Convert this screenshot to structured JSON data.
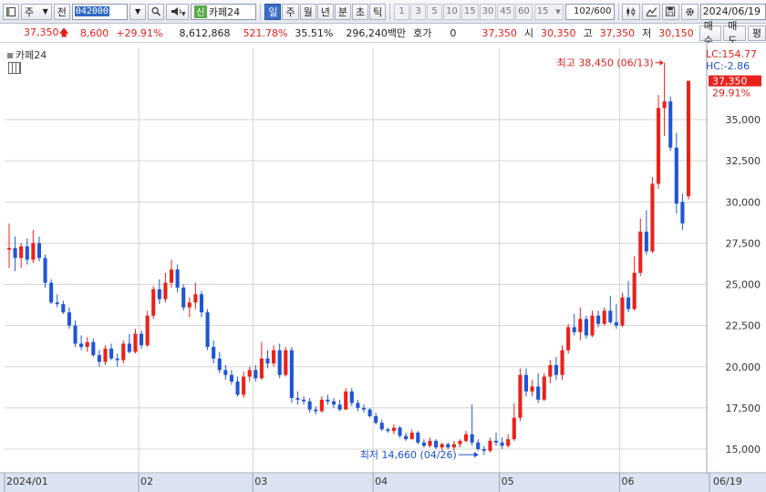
{
  "toolbar": {
    "market_label": "주",
    "all_label": "전",
    "code_value": "042000",
    "stock_badge": "신",
    "stock_name": "카페24",
    "periods": [
      "일",
      "주",
      "월",
      "년",
      "분",
      "초",
      "틱"
    ],
    "active_period": "일",
    "numbers": [
      "1",
      "3",
      "5",
      "10",
      "15",
      "30",
      "45",
      "60"
    ],
    "interval_value": "15",
    "count_value": "102",
    "count_total": "/600",
    "date_value": "2024/06/19"
  },
  "icons": [
    "window-icon",
    "dropdown-arrow-icon",
    "search-icon",
    "speaker-icon",
    "candle-icon",
    "chart-tools-icon",
    "save-icon",
    "gear-icon",
    "calculator-icon"
  ],
  "infobar": {
    "price": "37,350",
    "change": "8,600",
    "change_pct": "+29.91%",
    "volume": "8,612,868",
    "volume_ratio": "521.78%",
    "turnover": "35.51%",
    "amount": "296,240백만",
    "quote_label": "호가",
    "quote_value": "0",
    "quote_price": "37,350",
    "open_label": "시",
    "open": "30,350",
    "high_label": "고",
    "high": "37,350",
    "low_label": "저",
    "low": "30,150",
    "buy_button": "매수",
    "sell_button": "매도",
    "eval_button": "평"
  },
  "chart_data": {
    "type": "candlestick",
    "title": "카페24",
    "colors": {
      "up": "#e8221b",
      "down": "#1f56d4",
      "grid": "#d4d4d4"
    },
    "ylim": [
      14000,
      39500
    ],
    "y_ticks": [
      15000,
      17500,
      20000,
      22500,
      25000,
      27500,
      30000,
      32500,
      35000
    ],
    "y_tick_labels": [
      "15,000",
      "17,500",
      "20,000",
      "22,500",
      "25,000",
      "27,500",
      "30,000",
      "32,500",
      "35,000"
    ],
    "x_labels": [
      "2024/01",
      "02",
      "03",
      "04",
      "05",
      "06",
      "06/19"
    ],
    "x_label_dates": [
      "2024-01-02",
      "2024-02-01",
      "2024-03-04",
      "2024-04-01",
      "2024-05-02",
      "2024-06-03",
      "2024-06-19"
    ],
    "lc_label": "LC:154.77",
    "hc_label": "HC:-2.86",
    "last_price_label": "37,350",
    "last_change_label": "29.91%",
    "high_annotation": "최고 38,450 (06/13)",
    "low_annotation": "최저 14,660 (04/26)",
    "candles": [
      {
        "date": "2024-01-02",
        "o": 27100,
        "h": 28700,
        "l": 26000,
        "c": 27200
      },
      {
        "date": "2024-01-03",
        "o": 27200,
        "h": 27900,
        "l": 25800,
        "c": 26600
      },
      {
        "date": "2024-01-04",
        "o": 26600,
        "h": 27500,
        "l": 26000,
        "c": 27300
      },
      {
        "date": "2024-01-05",
        "o": 27300,
        "h": 27800,
        "l": 26200,
        "c": 26500
      },
      {
        "date": "2024-01-08",
        "o": 26500,
        "h": 28300,
        "l": 26300,
        "c": 27500
      },
      {
        "date": "2024-01-09",
        "o": 27500,
        "h": 27900,
        "l": 26400,
        "c": 26600
      },
      {
        "date": "2024-01-10",
        "o": 26600,
        "h": 26800,
        "l": 24800,
        "c": 25100
      },
      {
        "date": "2024-01-11",
        "o": 25100,
        "h": 25300,
        "l": 23800,
        "c": 23900
      },
      {
        "date": "2024-01-12",
        "o": 23900,
        "h": 24400,
        "l": 23600,
        "c": 23800
      },
      {
        "date": "2024-01-15",
        "o": 23800,
        "h": 24000,
        "l": 23200,
        "c": 23300
      },
      {
        "date": "2024-01-16",
        "o": 23300,
        "h": 23600,
        "l": 22300,
        "c": 22500
      },
      {
        "date": "2024-01-17",
        "o": 22500,
        "h": 22800,
        "l": 21200,
        "c": 21400
      },
      {
        "date": "2024-01-18",
        "o": 21400,
        "h": 21900,
        "l": 21000,
        "c": 21200
      },
      {
        "date": "2024-01-19",
        "o": 21200,
        "h": 21800,
        "l": 20900,
        "c": 21500
      },
      {
        "date": "2024-01-22",
        "o": 21500,
        "h": 21700,
        "l": 20600,
        "c": 20700
      },
      {
        "date": "2024-01-23",
        "o": 20700,
        "h": 21000,
        "l": 20000,
        "c": 20300
      },
      {
        "date": "2024-01-24",
        "o": 20300,
        "h": 21300,
        "l": 20100,
        "c": 21100
      },
      {
        "date": "2024-01-25",
        "o": 21100,
        "h": 21400,
        "l": 20400,
        "c": 20500
      },
      {
        "date": "2024-01-26",
        "o": 20500,
        "h": 20800,
        "l": 20000,
        "c": 20400
      },
      {
        "date": "2024-01-29",
        "o": 20400,
        "h": 21600,
        "l": 20200,
        "c": 21400
      },
      {
        "date": "2024-01-30",
        "o": 21400,
        "h": 22000,
        "l": 20800,
        "c": 20900
      },
      {
        "date": "2024-01-31",
        "o": 20900,
        "h": 22300,
        "l": 20800,
        "c": 22000
      },
      {
        "date": "2024-02-01",
        "o": 22000,
        "h": 22200,
        "l": 21100,
        "c": 21300
      },
      {
        "date": "2024-02-02",
        "o": 21300,
        "h": 23400,
        "l": 21200,
        "c": 23100
      },
      {
        "date": "2024-02-05",
        "o": 23100,
        "h": 24900,
        "l": 22900,
        "c": 24700
      },
      {
        "date": "2024-02-06",
        "o": 24700,
        "h": 25300,
        "l": 23800,
        "c": 24100
      },
      {
        "date": "2024-02-07",
        "o": 24100,
        "h": 25700,
        "l": 23900,
        "c": 25100
      },
      {
        "date": "2024-02-08",
        "o": 25100,
        "h": 26500,
        "l": 24800,
        "c": 25900
      },
      {
        "date": "2024-02-13",
        "o": 25900,
        "h": 26200,
        "l": 24500,
        "c": 24800
      },
      {
        "date": "2024-02-14",
        "o": 24800,
        "h": 25000,
        "l": 23400,
        "c": 23600
      },
      {
        "date": "2024-02-15",
        "o": 23600,
        "h": 24200,
        "l": 23000,
        "c": 23900
      },
      {
        "date": "2024-02-16",
        "o": 23900,
        "h": 25100,
        "l": 23500,
        "c": 24400
      },
      {
        "date": "2024-02-19",
        "o": 24400,
        "h": 24600,
        "l": 23000,
        "c": 23300
      },
      {
        "date": "2024-02-20",
        "o": 23300,
        "h": 23500,
        "l": 21000,
        "c": 21200
      },
      {
        "date": "2024-02-21",
        "o": 21200,
        "h": 21600,
        "l": 20200,
        "c": 20500
      },
      {
        "date": "2024-02-22",
        "o": 20500,
        "h": 20900,
        "l": 19600,
        "c": 19800
      },
      {
        "date": "2024-02-23",
        "o": 19800,
        "h": 20100,
        "l": 19200,
        "c": 19500
      },
      {
        "date": "2024-02-26",
        "o": 19500,
        "h": 19800,
        "l": 18900,
        "c": 19100
      },
      {
        "date": "2024-02-27",
        "o": 19100,
        "h": 19400,
        "l": 18200,
        "c": 18300
      },
      {
        "date": "2024-02-28",
        "o": 18300,
        "h": 19700,
        "l": 18100,
        "c": 19400
      },
      {
        "date": "2024-02-29",
        "o": 19400,
        "h": 20000,
        "l": 19100,
        "c": 19800
      },
      {
        "date": "2024-03-04",
        "o": 19800,
        "h": 20100,
        "l": 19100,
        "c": 19300
      },
      {
        "date": "2024-03-05",
        "o": 19300,
        "h": 21500,
        "l": 19200,
        "c": 20500
      },
      {
        "date": "2024-03-06",
        "o": 20500,
        "h": 21000,
        "l": 19900,
        "c": 20200
      },
      {
        "date": "2024-03-07",
        "o": 20200,
        "h": 21300,
        "l": 20000,
        "c": 21000
      },
      {
        "date": "2024-03-08",
        "o": 21000,
        "h": 21400,
        "l": 19300,
        "c": 19500
      },
      {
        "date": "2024-03-11",
        "o": 19500,
        "h": 21200,
        "l": 19400,
        "c": 21000
      },
      {
        "date": "2024-03-12",
        "o": 21000,
        "h": 21200,
        "l": 17800,
        "c": 18100
      },
      {
        "date": "2024-03-13",
        "o": 18100,
        "h": 18500,
        "l": 17700,
        "c": 18000
      },
      {
        "date": "2024-03-14",
        "o": 18000,
        "h": 18200,
        "l": 17700,
        "c": 17900
      },
      {
        "date": "2024-03-15",
        "o": 17900,
        "h": 18100,
        "l": 17200,
        "c": 17400
      },
      {
        "date": "2024-03-18",
        "o": 17400,
        "h": 17600,
        "l": 17100,
        "c": 17300
      },
      {
        "date": "2024-03-19",
        "o": 17300,
        "h": 18200,
        "l": 17200,
        "c": 18000
      },
      {
        "date": "2024-03-20",
        "o": 18000,
        "h": 18300,
        "l": 17700,
        "c": 17900
      },
      {
        "date": "2024-03-21",
        "o": 17900,
        "h": 18100,
        "l": 17500,
        "c": 17700
      },
      {
        "date": "2024-03-22",
        "o": 17700,
        "h": 18000,
        "l": 17300,
        "c": 17400
      },
      {
        "date": "2024-03-25",
        "o": 17400,
        "h": 18700,
        "l": 17400,
        "c": 18500
      },
      {
        "date": "2024-03-26",
        "o": 18500,
        "h": 18700,
        "l": 17600,
        "c": 17800
      },
      {
        "date": "2024-03-27",
        "o": 17800,
        "h": 18000,
        "l": 17300,
        "c": 17500
      },
      {
        "date": "2024-03-28",
        "o": 17500,
        "h": 17700,
        "l": 17200,
        "c": 17400
      },
      {
        "date": "2024-03-29",
        "o": 17400,
        "h": 17500,
        "l": 16900,
        "c": 17000
      },
      {
        "date": "2024-04-01",
        "o": 17000,
        "h": 17200,
        "l": 16500,
        "c": 16600
      },
      {
        "date": "2024-04-02",
        "o": 16600,
        "h": 16800,
        "l": 16100,
        "c": 16200
      },
      {
        "date": "2024-04-03",
        "o": 16200,
        "h": 16300,
        "l": 16000,
        "c": 16100
      },
      {
        "date": "2024-04-04",
        "o": 16100,
        "h": 16500,
        "l": 15900,
        "c": 16300
      },
      {
        "date": "2024-04-05",
        "o": 16300,
        "h": 16400,
        "l": 15700,
        "c": 15800
      },
      {
        "date": "2024-04-08",
        "o": 15800,
        "h": 16000,
        "l": 15500,
        "c": 15600
      },
      {
        "date": "2024-04-09",
        "o": 15600,
        "h": 16200,
        "l": 15600,
        "c": 16000
      },
      {
        "date": "2024-04-11",
        "o": 16000,
        "h": 16100,
        "l": 15300,
        "c": 15400
      },
      {
        "date": "2024-04-12",
        "o": 15400,
        "h": 15600,
        "l": 15100,
        "c": 15200
      },
      {
        "date": "2024-04-15",
        "o": 15200,
        "h": 15700,
        "l": 15100,
        "c": 15500
      },
      {
        "date": "2024-04-16",
        "o": 15500,
        "h": 15600,
        "l": 15000,
        "c": 15100
      },
      {
        "date": "2024-04-17",
        "o": 15100,
        "h": 15400,
        "l": 14900,
        "c": 15300
      },
      {
        "date": "2024-04-18",
        "o": 15300,
        "h": 15400,
        "l": 15000,
        "c": 15100
      },
      {
        "date": "2024-04-19",
        "o": 15100,
        "h": 15500,
        "l": 14900,
        "c": 15300
      },
      {
        "date": "2024-04-22",
        "o": 15300,
        "h": 15600,
        "l": 15100,
        "c": 15500
      },
      {
        "date": "2024-04-23",
        "o": 15500,
        "h": 16100,
        "l": 15400,
        "c": 15900
      },
      {
        "date": "2024-04-24",
        "o": 15900,
        "h": 17700,
        "l": 15200,
        "c": 15400
      },
      {
        "date": "2024-04-25",
        "o": 15400,
        "h": 15600,
        "l": 14900,
        "c": 15000
      },
      {
        "date": "2024-04-26",
        "o": 15000,
        "h": 15200,
        "l": 14660,
        "c": 14900
      },
      {
        "date": "2024-04-29",
        "o": 14900,
        "h": 15700,
        "l": 14800,
        "c": 15500
      },
      {
        "date": "2024-04-30",
        "o": 15500,
        "h": 16000,
        "l": 15200,
        "c": 15400
      },
      {
        "date": "2024-05-02",
        "o": 15400,
        "h": 15700,
        "l": 15000,
        "c": 15200
      },
      {
        "date": "2024-05-03",
        "o": 15200,
        "h": 15900,
        "l": 15100,
        "c": 15600
      },
      {
        "date": "2024-05-07",
        "o": 15600,
        "h": 17800,
        "l": 15500,
        "c": 16900
      },
      {
        "date": "2024-05-08",
        "o": 16900,
        "h": 19900,
        "l": 16700,
        "c": 19500
      },
      {
        "date": "2024-05-09",
        "o": 19500,
        "h": 19900,
        "l": 18200,
        "c": 18500
      },
      {
        "date": "2024-05-10",
        "o": 18500,
        "h": 19200,
        "l": 18200,
        "c": 18800
      },
      {
        "date": "2024-05-13",
        "o": 18800,
        "h": 19600,
        "l": 17800,
        "c": 18000
      },
      {
        "date": "2024-05-14",
        "o": 18000,
        "h": 19600,
        "l": 17900,
        "c": 19400
      },
      {
        "date": "2024-05-16",
        "o": 19400,
        "h": 20400,
        "l": 19000,
        "c": 20100
      },
      {
        "date": "2024-05-17",
        "o": 20100,
        "h": 20600,
        "l": 19200,
        "c": 19500
      },
      {
        "date": "2024-05-20",
        "o": 19500,
        "h": 21300,
        "l": 19200,
        "c": 21000
      },
      {
        "date": "2024-05-21",
        "o": 21000,
        "h": 22600,
        "l": 20800,
        "c": 22400
      },
      {
        "date": "2024-05-22",
        "o": 22400,
        "h": 23200,
        "l": 21900,
        "c": 22100
      },
      {
        "date": "2024-05-23",
        "o": 22100,
        "h": 23600,
        "l": 21600,
        "c": 22900
      },
      {
        "date": "2024-05-24",
        "o": 22900,
        "h": 23100,
        "l": 21700,
        "c": 21900
      },
      {
        "date": "2024-05-27",
        "o": 21900,
        "h": 23400,
        "l": 21800,
        "c": 23100
      },
      {
        "date": "2024-05-28",
        "o": 23100,
        "h": 23400,
        "l": 22400,
        "c": 22600
      },
      {
        "date": "2024-05-29",
        "o": 22600,
        "h": 23600,
        "l": 22500,
        "c": 23400
      },
      {
        "date": "2024-05-30",
        "o": 23400,
        "h": 24300,
        "l": 22600,
        "c": 22700
      },
      {
        "date": "2024-05-31",
        "o": 22700,
        "h": 23800,
        "l": 22300,
        "c": 22500
      },
      {
        "date": "2024-06-03",
        "o": 22500,
        "h": 24500,
        "l": 22400,
        "c": 24200
      },
      {
        "date": "2024-06-04",
        "o": 24200,
        "h": 25200,
        "l": 23300,
        "c": 23500
      },
      {
        "date": "2024-06-05",
        "o": 23500,
        "h": 26700,
        "l": 23400,
        "c": 25700
      },
      {
        "date": "2024-06-07",
        "o": 25700,
        "h": 29000,
        "l": 25500,
        "c": 28200
      },
      {
        "date": "2024-06-10",
        "o": 28200,
        "h": 29500,
        "l": 26800,
        "c": 27000
      },
      {
        "date": "2024-06-11",
        "o": 27000,
        "h": 31500,
        "l": 26900,
        "c": 31100
      },
      {
        "date": "2024-06-12",
        "o": 31100,
        "h": 36500,
        "l": 30800,
        "c": 35700
      },
      {
        "date": "2024-06-13",
        "o": 35700,
        "h": 38450,
        "l": 34000,
        "c": 36100
      },
      {
        "date": "2024-06-14",
        "o": 36100,
        "h": 36400,
        "l": 33100,
        "c": 33300
      },
      {
        "date": "2024-06-17",
        "o": 33300,
        "h": 34200,
        "l": 29300,
        "c": 29900
      },
      {
        "date": "2024-06-18",
        "o": 30000,
        "h": 30500,
        "l": 28300,
        "c": 28700
      },
      {
        "date": "2024-06-19",
        "o": 30350,
        "h": 37350,
        "l": 30150,
        "c": 37350
      }
    ]
  }
}
